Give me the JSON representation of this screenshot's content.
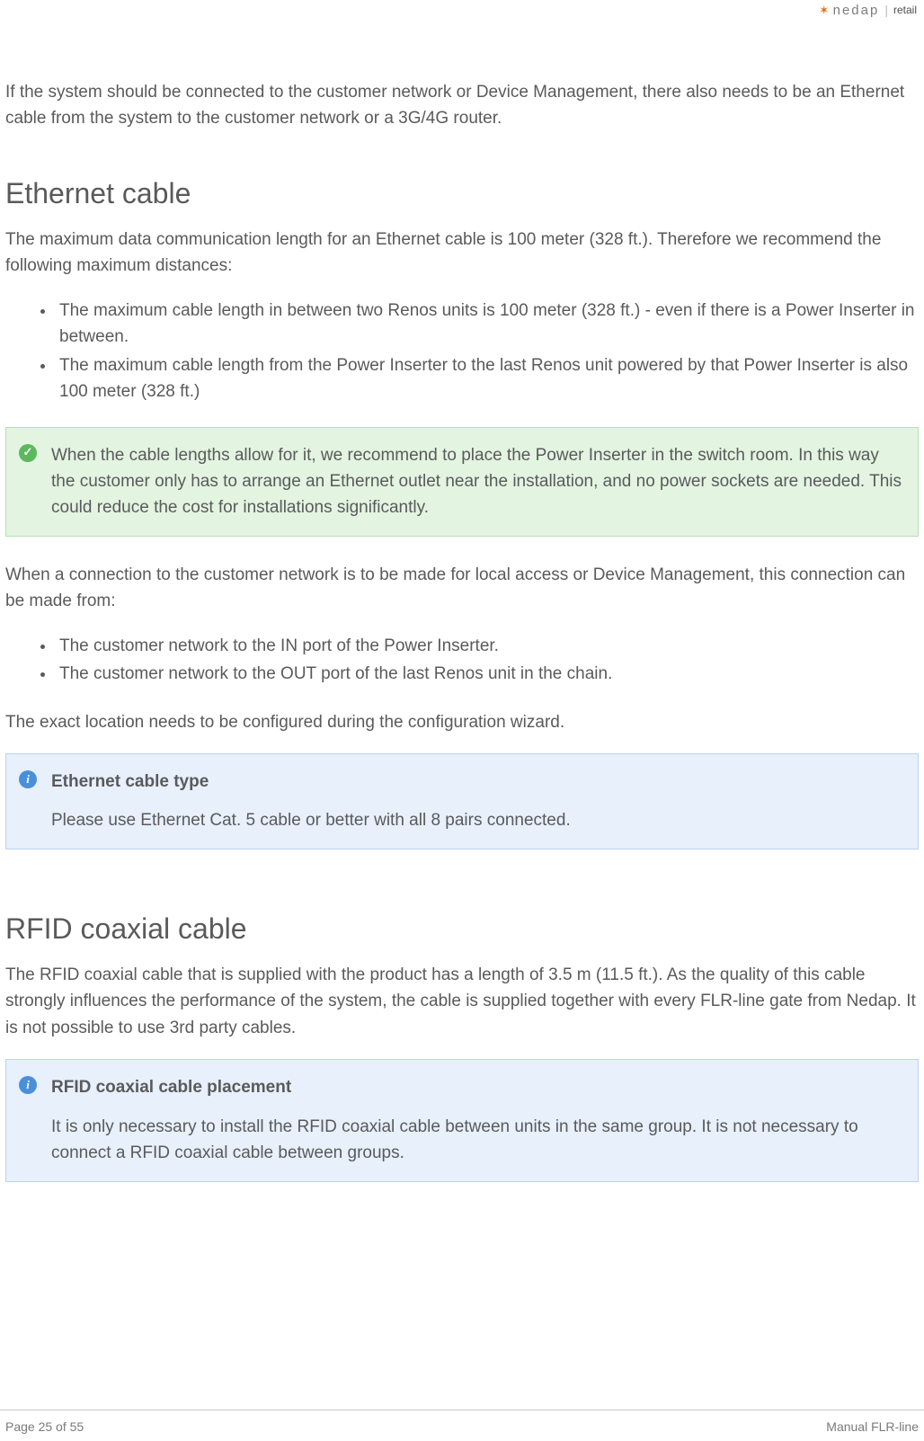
{
  "header": {
    "logo_star": "✶",
    "logo_word": "nedap",
    "logo_sep": "|",
    "logo_retail": "retail"
  },
  "intro": "If the system should be connected to the customer network or Device Management, there also needs to be an Ethernet cable from the system to the customer network or a 3G/4G router.",
  "ethernet": {
    "heading": "Ethernet cable",
    "lead": "The maximum data communication length for an Ethernet cable is 100 meter (328 ft.). Therefore we recommend the following maximum distances:",
    "bullets": [
      "The maximum cable length in between two Renos units is 100 meter (328 ft.) - even if there is a Power Inserter in between.",
      "The maximum cable length from the Power Inserter to the last Renos unit powered by that Power Inserter is also 100 meter (328 ft.)"
    ],
    "tip": "When the cable lengths allow for it, we recommend to place the Power Inserter in the switch room. In this way the customer only has to arrange an Ethernet outlet near the installation, and no power sockets are needed. This could reduce the cost for installations significantly.",
    "conn_lead": "When a connection to the customer network is to be made for local access or Device Management, this connection can be made from:",
    "conn_bullets": [
      "The customer network to the IN port of the Power Inserter.",
      "The customer network to the OUT port of the last Renos unit in the chain."
    ],
    "conn_tail": "The exact location needs to be configured during the configuration wizard.",
    "info_title": "Ethernet cable type",
    "info_text": "Please use Ethernet Cat. 5 cable or better with all 8 pairs connected."
  },
  "rfid": {
    "heading": "RFID coaxial cable",
    "lead": "The RFID coaxial cable that is supplied with the product has a length of 3.5 m (11.5 ft.). As the quality of this cable strongly influences the performance of the system, the cable is supplied together with every FLR-line gate from Nedap. It is not possible to use 3rd party cables.",
    "info_title": "RFID coaxial cable placement",
    "info_text": "It is only necessary to install the RFID coaxial cable between units in the same group. It is not necessary to connect a RFID coaxial cable between groups."
  },
  "footer": {
    "page": "Page 25 of 55",
    "doc": "Manual FLR-line"
  }
}
